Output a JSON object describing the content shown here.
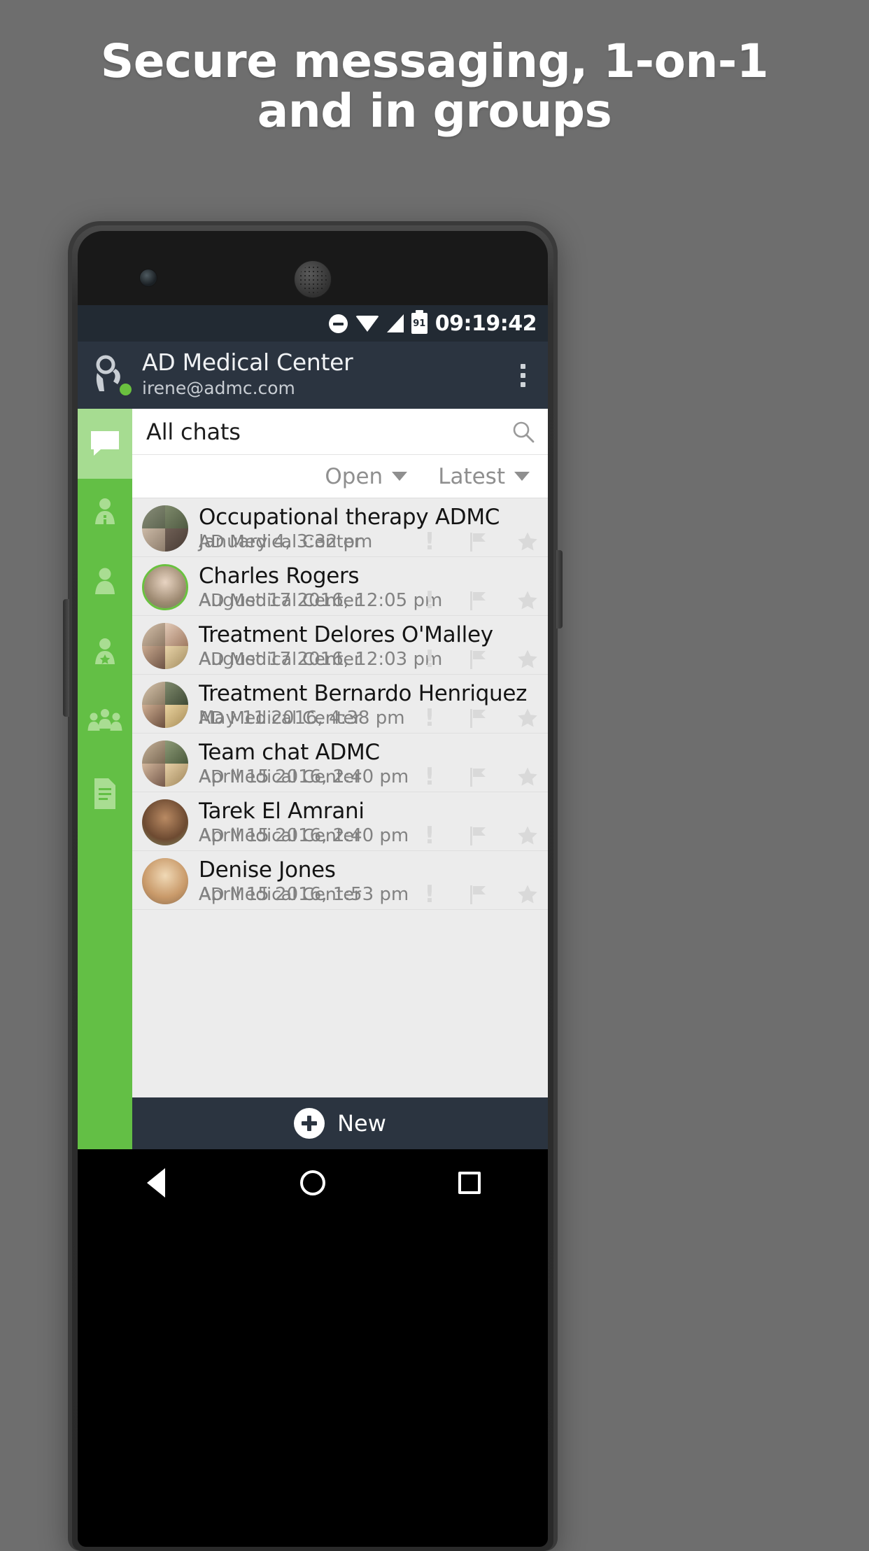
{
  "promo": {
    "line1": "Secure messaging,  1-on-1",
    "line2": "and in groups"
  },
  "colors": {
    "page_background": "#6e6e6e",
    "brand_green": "#63bf45",
    "rail_active_green": "#a6dc91",
    "header_dark": "#2b3440",
    "status_bar_dark": "#222a33",
    "list_background": "#ececec",
    "presence_online": "#6ac13f"
  },
  "status_bar": {
    "time": "09:19:42",
    "battery_level": "91",
    "icons": [
      "do-not-disturb-icon",
      "wifi-icon",
      "cell-signal-icon",
      "battery-icon"
    ]
  },
  "app_header": {
    "logo_icon": "person-avatar-logo",
    "title": "AD Medical Center",
    "subtitle": "irene@admc.com",
    "presence": "online",
    "overflow_icon": "overflow-menu-icon"
  },
  "nav_rail": {
    "items": [
      {
        "icon": "chat-bubble-icon",
        "name": "chats",
        "active": true
      },
      {
        "icon": "patient-info-icon",
        "name": "patients",
        "active": false
      },
      {
        "icon": "person-icon",
        "name": "contacts",
        "active": false
      },
      {
        "icon": "person-star-icon",
        "name": "favorites",
        "active": false
      },
      {
        "icon": "group-people-icon",
        "name": "groups",
        "active": false
      },
      {
        "icon": "document-icon",
        "name": "documents",
        "active": false
      }
    ]
  },
  "search": {
    "value": "All chats",
    "placeholder": "All chats",
    "icon": "search-icon"
  },
  "filters": [
    {
      "label": "Open",
      "icon": "chevron-down-icon"
    },
    {
      "label": "Latest",
      "icon": "chevron-down-icon"
    }
  ],
  "chat_list": {
    "org_label": "AD Medical Center",
    "row_actions": [
      {
        "name": "urgent-action",
        "icon": "exclamation-icon"
      },
      {
        "name": "flag-action",
        "icon": "flag-icon"
      },
      {
        "name": "favorite-action",
        "icon": "star-icon"
      }
    ],
    "rows": [
      {
        "title": "Occupational therapy ADMC",
        "org": "AD Medical Center",
        "time": "January 4, 3:32 pm",
        "avatar": "group-4-tile",
        "online": false
      },
      {
        "title": "Charles Rogers",
        "org": "AD Medical Center",
        "time": "August 17 2016, 12:05 pm",
        "avatar": "single-photo",
        "online": true
      },
      {
        "title": "Treatment Delores O'Malley",
        "org": "AD Medical Center",
        "time": "August 17 2016, 12:03 pm",
        "avatar": "group-4-tile",
        "online": false
      },
      {
        "title": "Treatment Bernardo Henriquez",
        "org": "AD Medical Center",
        "time": "May 11 2016, 4:38 pm",
        "avatar": "group-4-tile",
        "online": false
      },
      {
        "title": "Team chat ADMC",
        "org": "AD Medical Center",
        "time": "April 15 2016, 2:40 pm",
        "avatar": "group-4-tile",
        "online": false
      },
      {
        "title": "Tarek El Amrani",
        "org": "AD Medical Center",
        "time": "April 15 2016, 2:40 pm",
        "avatar": "single-photo",
        "online": false
      },
      {
        "title": "Denise Jones",
        "org": "AD Medical Center",
        "time": "April 15 2016, 1:53 pm",
        "avatar": "single-photo",
        "online": false
      }
    ]
  },
  "new_bar": {
    "label": "New",
    "icon": "plus-circle-icon"
  },
  "android_nav": {
    "back": "back-triangle-icon",
    "home": "home-circle-icon",
    "recents": "recents-square-icon"
  }
}
